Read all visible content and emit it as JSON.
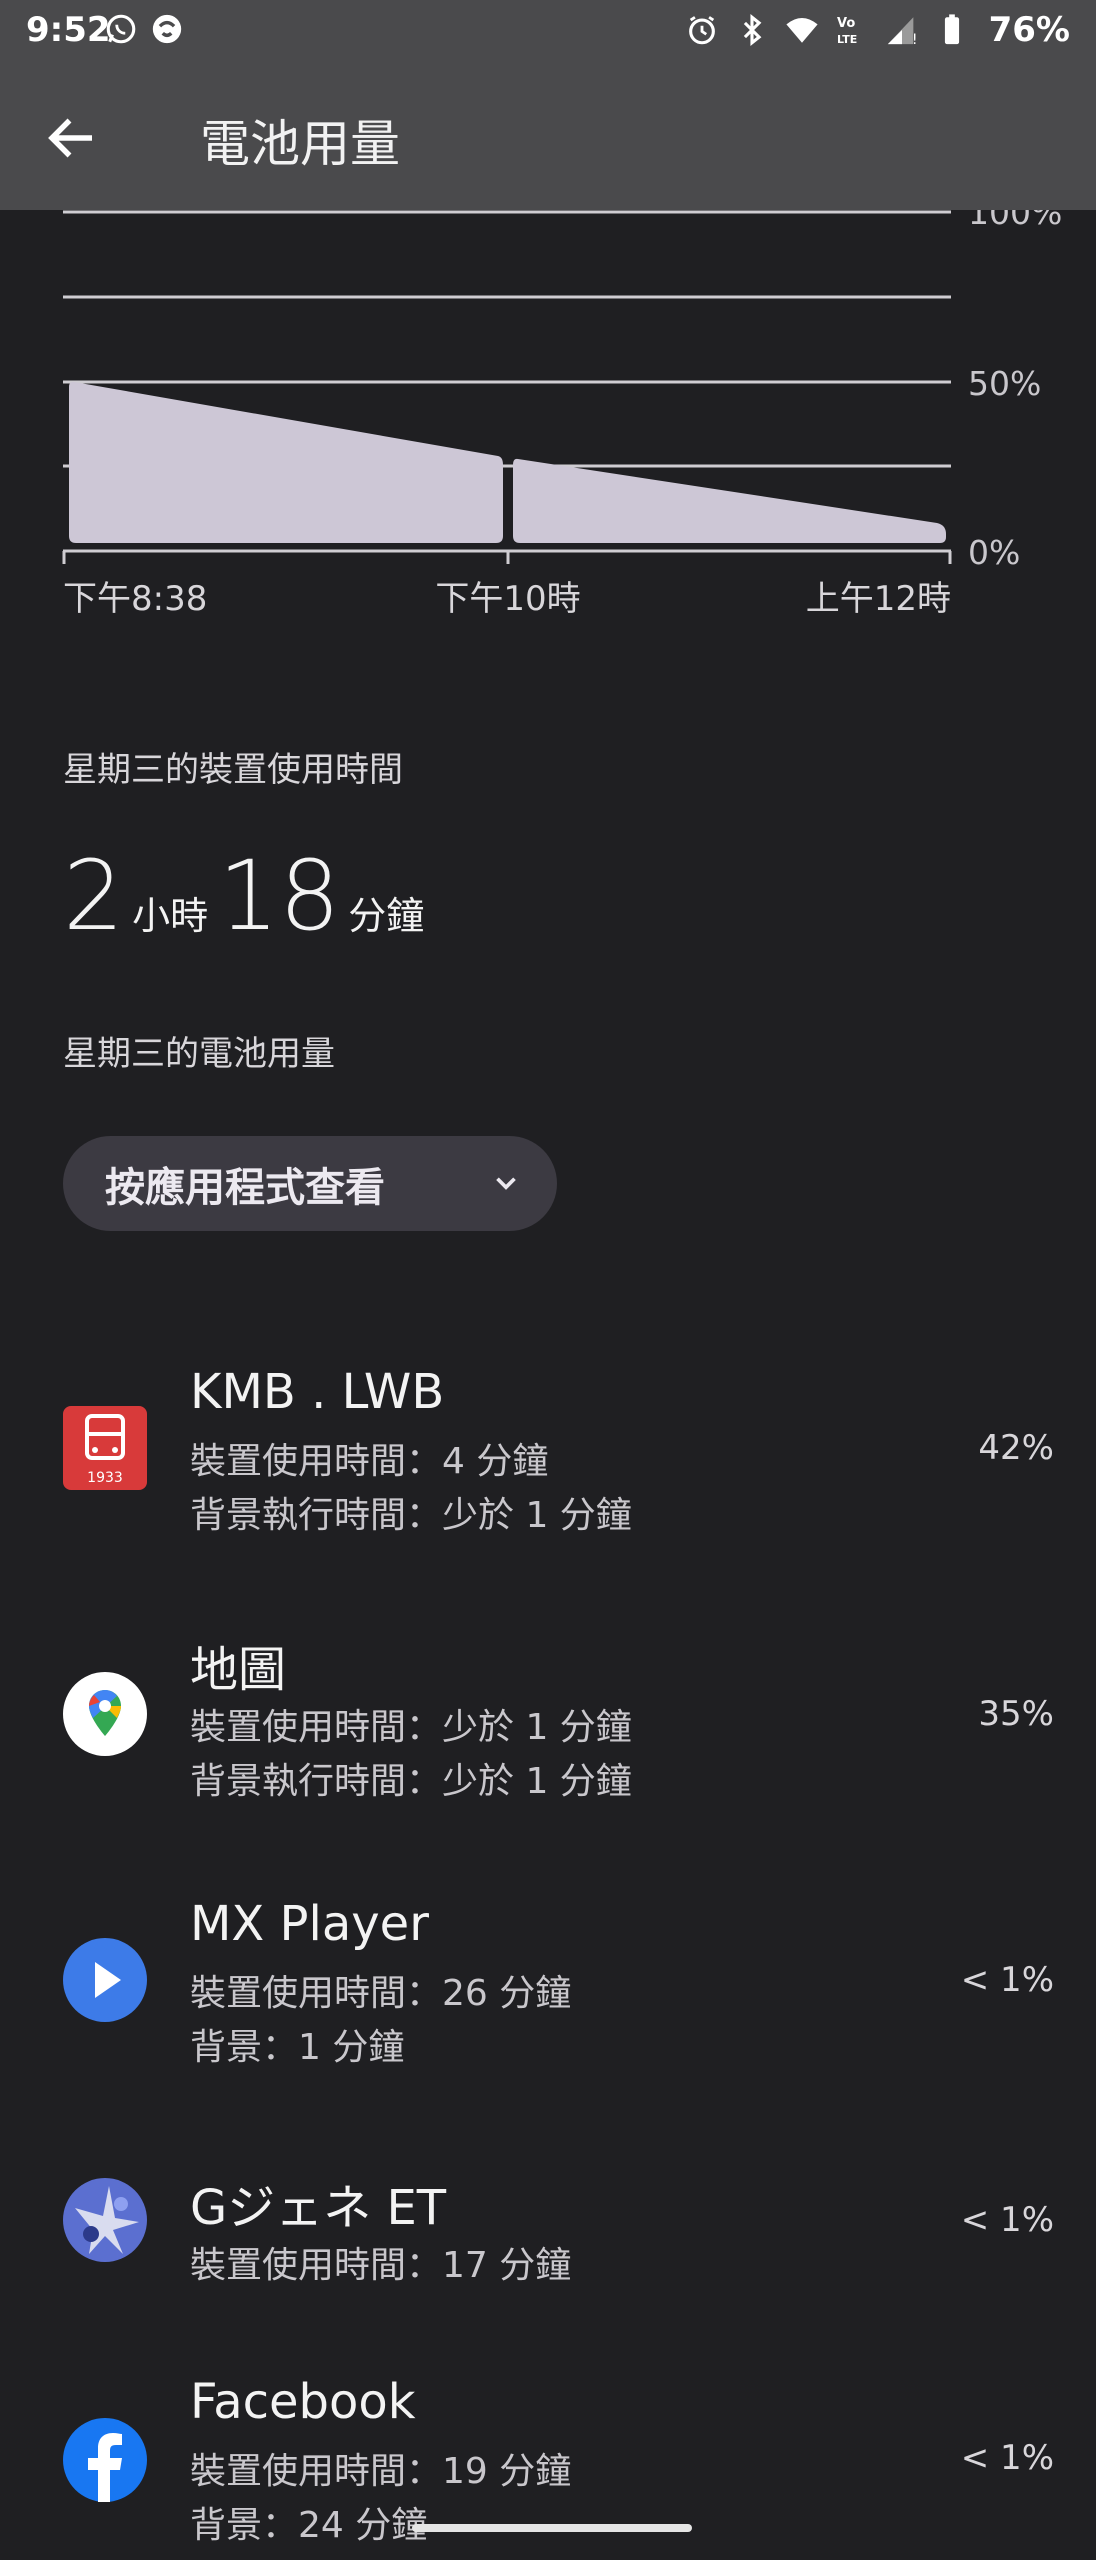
{
  "status_bar": {
    "time": "9:52",
    "battery": "76%",
    "lte_label": "LTE"
  },
  "app_bar": {
    "title": "電池用量"
  },
  "chart_data": {
    "type": "area",
    "y_tick_labels": [
      "100%",
      "50%",
      "0%"
    ],
    "x_tick_labels": [
      "下午8:38",
      "下午10時",
      "上午12時"
    ],
    "ylim": [
      0,
      100
    ],
    "grid": true,
    "series": [
      {
        "x": [
          "下午8:38",
          "下午9:52"
        ],
        "y": [
          49,
          27
        ]
      },
      {
        "x": [
          "下午9:55",
          "上午12時"
        ],
        "y": [
          26,
          6
        ]
      }
    ]
  },
  "screen_time": {
    "label": "星期三的裝置使用時間",
    "hours": "2",
    "hours_unit": "小時",
    "minutes": "18",
    "minutes_unit": "分鐘"
  },
  "battery_usage_label": "星期三的電池用量",
  "dropdown": {
    "selected": "按應用程式查看"
  },
  "apps": [
    {
      "name": "KMB . LWB",
      "lines": [
        "裝置使用時間：4 分鐘",
        "背景執行時間：少於 1 分鐘"
      ],
      "percent": "42%",
      "icon": "kmb-bus-icon",
      "icon_text": "1933",
      "color": "#d83a3a"
    },
    {
      "name": "地圖",
      "lines": [
        "裝置使用時間：少於 1 分鐘",
        "背景執行時間：少於 1 分鐘"
      ],
      "percent": "35%",
      "icon": "maps-icon",
      "color": "#ffffff"
    },
    {
      "name": "MX Player",
      "lines": [
        "裝置使用時間：26 分鐘",
        "背景：1 分鐘"
      ],
      "percent": "< 1%",
      "icon": "mx-player-icon",
      "color": "#3d7be8"
    },
    {
      "name": "Gジェネ ET",
      "lines": [
        "裝置使用時間：17 分鐘"
      ],
      "percent": "< 1%",
      "icon": "g-gene-icon",
      "color": "#5b6fd0"
    },
    {
      "name": "Facebook",
      "lines": [
        "裝置使用時間：19 分鐘",
        "背景：24 分鐘"
      ],
      "percent": "< 1%",
      "icon": "facebook-icon",
      "color": "#1877f2"
    }
  ]
}
